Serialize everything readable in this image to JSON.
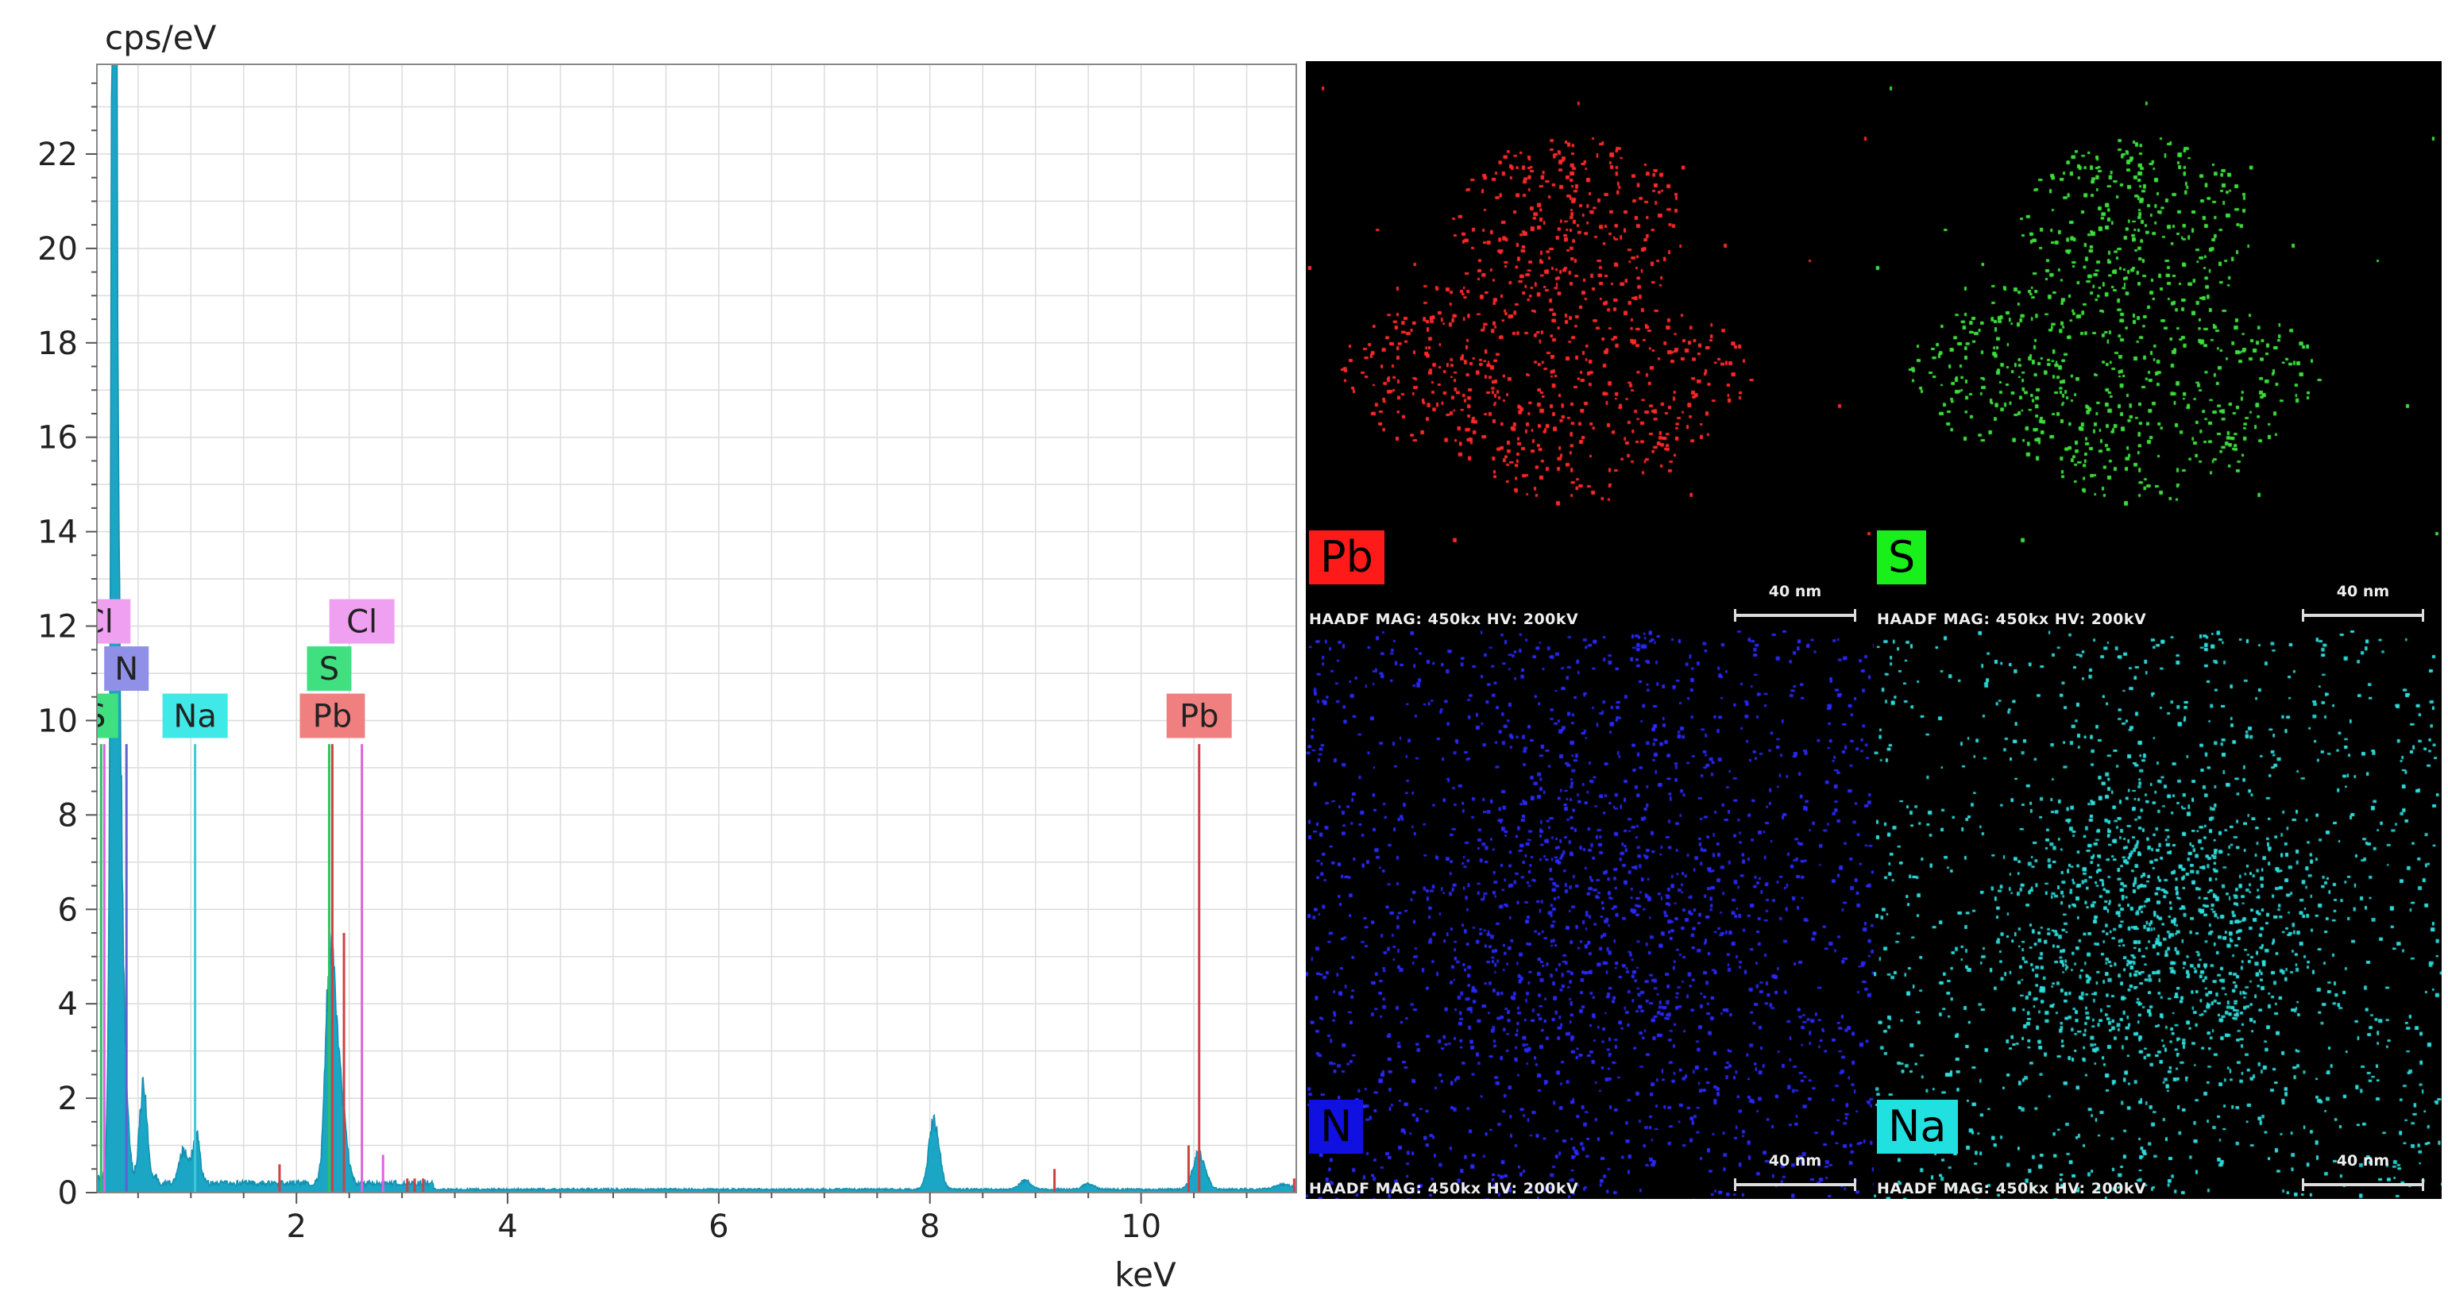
{
  "chart_data": {
    "type": "line",
    "title": "",
    "ylabel": "cps/eV",
    "xlabel": "keV",
    "xlim": [
      0.11,
      11.47
    ],
    "ylim": [
      0,
      23.9
    ],
    "xticks": [
      2,
      4,
      6,
      8,
      10
    ],
    "yticks": [
      0,
      2,
      4,
      6,
      8,
      10,
      12,
      14,
      16,
      18,
      20,
      22
    ],
    "grid": true,
    "series_color": "#1aa6c4",
    "background": 0.2,
    "peaks": [
      {
        "x": 0.27,
        "y": 22.7,
        "w": 0.025
      },
      {
        "x": 0.3,
        "y": 13.0,
        "w": 0.04
      },
      {
        "x": 0.39,
        "y": 1.2,
        "w": 0.03
      },
      {
        "x": 0.55,
        "y": 2.0,
        "w": 0.035
      },
      {
        "x": 0.93,
        "y": 0.7,
        "w": 0.04
      },
      {
        "x": 1.05,
        "y": 1.0,
        "w": 0.035
      },
      {
        "x": 2.31,
        "y": 3.2,
        "w": 0.04
      },
      {
        "x": 2.36,
        "y": 2.8,
        "w": 0.05
      },
      {
        "x": 2.45,
        "y": 1.0,
        "w": 0.04
      },
      {
        "x": 8.04,
        "y": 1.45,
        "w": 0.05
      },
      {
        "x": 8.9,
        "y": 0.2,
        "w": 0.05
      },
      {
        "x": 9.5,
        "y": 0.12,
        "w": 0.05
      },
      {
        "x": 10.55,
        "y": 0.75,
        "w": 0.06
      },
      {
        "x": 11.35,
        "y": 0.1,
        "w": 0.08
      }
    ],
    "markers": [
      {
        "element": "S",
        "x": 0.15,
        "height": 9.5,
        "color": "#30c060"
      },
      {
        "element": "Cl",
        "x": 0.18,
        "height": 9.5,
        "color": "#e060e0"
      },
      {
        "element": "N",
        "x": 0.39,
        "height": 9.5,
        "color": "#6060d0"
      },
      {
        "element": "Na",
        "x": 1.04,
        "height": 9.5,
        "color": "#40c8d8"
      },
      {
        "element": "S",
        "x": 2.31,
        "height": 9.5,
        "color": "#30c060"
      },
      {
        "element": "Pb",
        "x": 2.34,
        "height": 9.5,
        "color": "#d04040"
      },
      {
        "element": "Pb",
        "x": 2.45,
        "height": 5.5,
        "color": "#d04040"
      },
      {
        "element": "Cl",
        "x": 2.62,
        "height": 9.5,
        "color": "#e060e0"
      },
      {
        "element": "Cl",
        "x": 2.82,
        "height": 0.8,
        "color": "#e060e0"
      },
      {
        "element": "Pb",
        "x": 1.84,
        "height": 0.6,
        "color": "#d04040"
      },
      {
        "element": "Pb",
        "x": 3.05,
        "height": 0.3,
        "color": "#d04040"
      },
      {
        "element": "Pb",
        "x": 3.12,
        "height": 0.3,
        "color": "#d04040"
      },
      {
        "element": "Pb",
        "x": 3.2,
        "height": 0.3,
        "color": "#d04040"
      },
      {
        "element": "Pb",
        "x": 9.18,
        "height": 0.5,
        "color": "#d04040"
      },
      {
        "element": "Pb",
        "x": 10.45,
        "height": 1.0,
        "color": "#d04040"
      },
      {
        "element": "Pb",
        "x": 10.55,
        "height": 9.5,
        "color": "#d04040"
      },
      {
        "element": "Pb",
        "x": 11.45,
        "height": 0.3,
        "color": "#d04040"
      }
    ],
    "labels": [
      {
        "text": "Cl",
        "x": 0.12,
        "y": 12.1,
        "color": "#f0a0f0"
      },
      {
        "text": "N",
        "x": 0.39,
        "y": 11.1,
        "color": "#9090e8"
      },
      {
        "text": "S",
        "x": 0.1,
        "y": 10.1,
        "color": "#40e080"
      },
      {
        "text": "Na",
        "x": 1.04,
        "y": 10.1,
        "color": "#40e8e8"
      },
      {
        "text": "Cl",
        "x": 2.62,
        "y": 12.1,
        "color": "#f0a0f0"
      },
      {
        "text": "S",
        "x": 2.31,
        "y": 11.1,
        "color": "#40e080"
      },
      {
        "text": "Pb",
        "x": 2.34,
        "y": 10.1,
        "color": "#f08080"
      },
      {
        "text": "Pb",
        "x": 10.55,
        "y": 10.1,
        "color": "#f08080"
      }
    ]
  },
  "maps": [
    {
      "element": "Pb",
      "color": "#ff2a2a",
      "label_bg": "#ff1a1a",
      "info": "HAADF  MAG: 450kx  HV: 200kV",
      "scale": "40 nm",
      "pattern": "blob"
    },
    {
      "element": "S",
      "color": "#3ee03e",
      "label_bg": "#19f019",
      "info": "HAADF  MAG: 450kx  HV: 200kV",
      "scale": "40 nm",
      "pattern": "blob"
    },
    {
      "element": "N",
      "color": "#2a2aff",
      "label_bg": "#1010e0",
      "info": "HAADF  MAG: 450kx  HV: 200kV",
      "scale": "40 nm",
      "pattern": "diffuse"
    },
    {
      "element": "Na",
      "color": "#30e0e0",
      "label_bg": "#20e0e0",
      "info": "HAADF  MAG: 450kx  HV: 200kV",
      "scale": "40 nm",
      "pattern": "diffuse"
    }
  ]
}
